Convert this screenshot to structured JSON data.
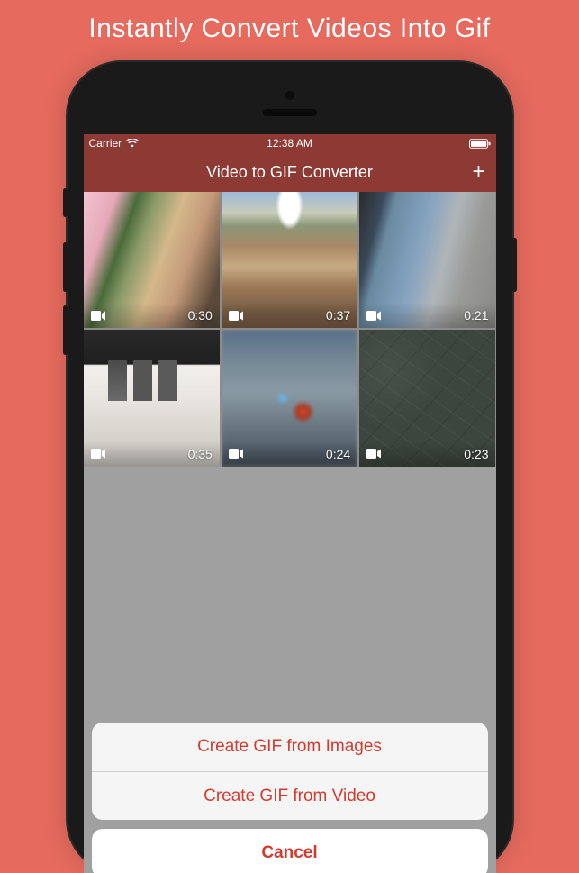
{
  "promo": {
    "title": "Instantly Convert Videos Into Gif"
  },
  "status_bar": {
    "carrier": "Carrier",
    "time": "12:38 AM"
  },
  "nav": {
    "title": "Video to GIF Converter",
    "add_label": "+"
  },
  "videos": [
    {
      "duration": "0:30"
    },
    {
      "duration": "0:37"
    },
    {
      "duration": "0:21"
    },
    {
      "duration": "0:35"
    },
    {
      "duration": "0:24"
    },
    {
      "duration": "0:23"
    }
  ],
  "action_sheet": {
    "options": [
      {
        "label": "Create GIF from Images"
      },
      {
        "label": "Create GIF from Video"
      }
    ],
    "cancel": "Cancel"
  }
}
